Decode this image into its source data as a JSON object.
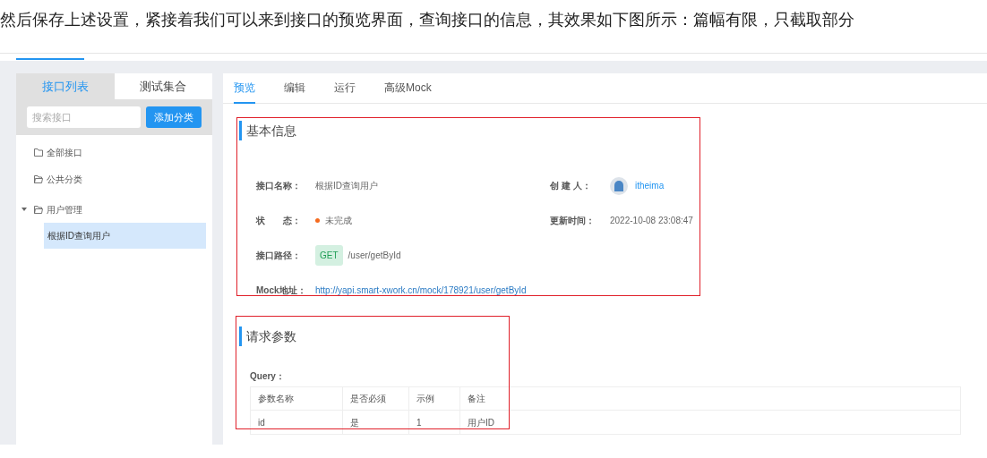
{
  "intro": "然后保存上述设置，紧接着我们可以来到接口的预览界面，查询接口的信息，其效果如下图所示：篇幅有限，只截取部分",
  "sidebar": {
    "tabs": [
      {
        "label": "接口列表",
        "selected": true
      },
      {
        "label": "测试集合",
        "selected": false
      }
    ],
    "search": {
      "placeholder": "搜索接口"
    },
    "add_button": "添加分类",
    "tree": [
      {
        "label": "全部接口",
        "kind": "folder",
        "selected": false
      },
      {
        "label": "公共分类",
        "kind": "open-folder",
        "selected": false
      },
      {
        "label": "用户管理",
        "kind": "open-folder",
        "selected": false,
        "expanded": true,
        "children": [
          {
            "label": "根据ID查询用户",
            "kind": "item",
            "selected": true
          }
        ]
      }
    ]
  },
  "tabs": [
    {
      "label": "预览",
      "selected": true
    },
    {
      "label": "编辑",
      "selected": false
    },
    {
      "label": "运行",
      "selected": false
    },
    {
      "label": "高级Mock",
      "selected": false
    }
  ],
  "basic_info": {
    "title": "基本信息",
    "fields": [
      {
        "label": "接口名称：",
        "kind": "text",
        "value": "根据ID查询用户"
      },
      {
        "label": "创 建 人：",
        "kind": "user",
        "value": "itheima"
      },
      {
        "label": "状　　态：",
        "kind": "status",
        "value": "未完成"
      },
      {
        "label": "更新时间：",
        "kind": "text",
        "value": "2022-10-08 23:08:47"
      },
      {
        "label": "接口路径：",
        "kind": "path",
        "method": "GET",
        "value": "/user/getById"
      },
      {
        "label": "Mock地址：",
        "kind": "link",
        "value": "http://yapi.smart-xwork.cn/mock/178921/user/getById"
      }
    ]
  },
  "request": {
    "title": "请求参数",
    "query_label": "Query：",
    "columns": [
      "参数名称",
      "是否必须",
      "示例",
      "备注"
    ],
    "rows": [
      [
        "id",
        "是",
        "1",
        "用户ID"
      ]
    ]
  }
}
